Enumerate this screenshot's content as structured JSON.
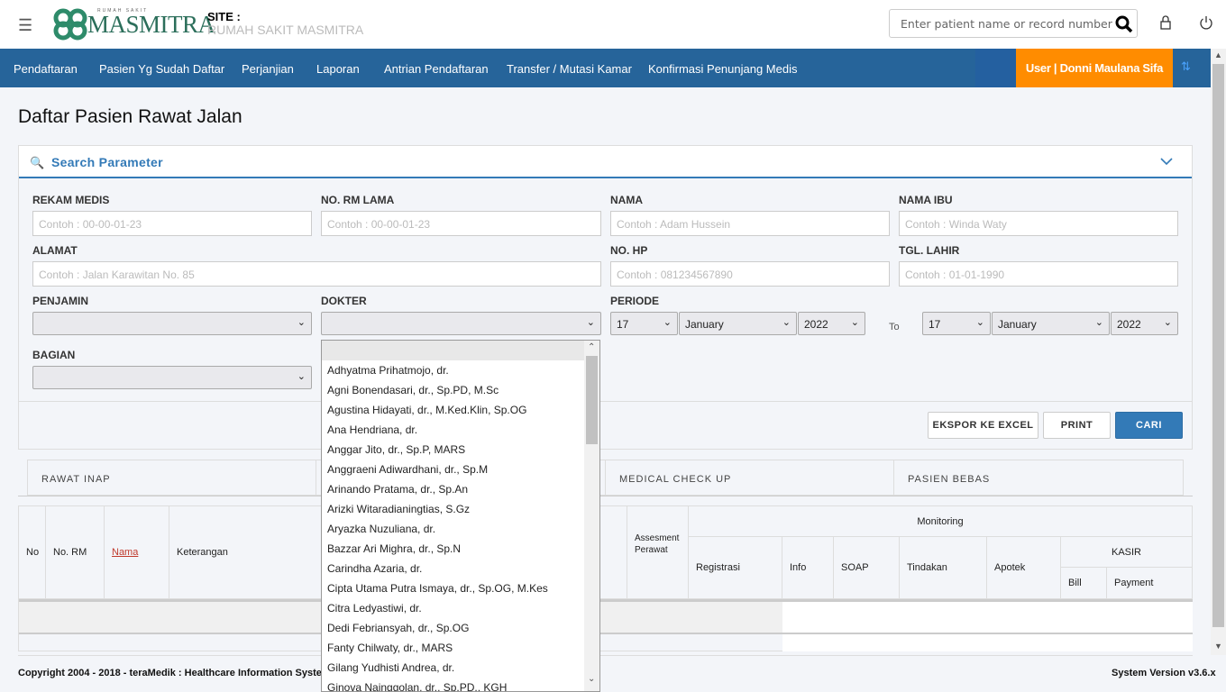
{
  "header": {
    "logo_small": "RUMAH SAKIT",
    "logo": "MASMITRA",
    "site_label": "SITE :",
    "site_name": "RUMAH SAKIT MASMITRA",
    "search_placeholder": "Enter patient name or record number"
  },
  "nav": {
    "items": [
      "Pendaftaran",
      "Pasien Yg Sudah Daftar",
      "Perjanjian",
      "Laporan",
      "Antrian Pendaftaran",
      "Transfer / Mutasi Kamar",
      "Konfirmasi Penunjang Medis"
    ],
    "user": "User | Donni Maulana Sifa"
  },
  "page": {
    "title": "Daftar Pasien Rawat Jalan"
  },
  "search": {
    "title": "Search Parameter",
    "fields": {
      "rekam_medis": {
        "label": "REKAM MEDIS",
        "placeholder": "Contoh : 00-00-01-23"
      },
      "no_rm_lama": {
        "label": "NO. RM LAMA",
        "placeholder": "Contoh : 00-00-01-23"
      },
      "nama": {
        "label": "NAMA",
        "placeholder": "Contoh : Adam Hussein"
      },
      "nama_ibu": {
        "label": "NAMA IBU",
        "placeholder": "Contoh : Winda Waty"
      },
      "alamat": {
        "label": "ALAMAT",
        "placeholder": "Contoh : Jalan Karawitan No. 85"
      },
      "no_hp": {
        "label": "NO. HP",
        "placeholder": "Contoh : 081234567890"
      },
      "tgl_lahir": {
        "label": "TGL. LAHIR",
        "placeholder": "Contoh : 01-01-1990"
      },
      "penjamin": {
        "label": "PENJAMIN",
        "value": ""
      },
      "dokter": {
        "label": "DOKTER",
        "value": ""
      },
      "periode": {
        "label": "PERIODE",
        "from_day": "17",
        "from_month": "January",
        "from_year": "2022",
        "to": "To",
        "to_day": "17",
        "to_month": "January",
        "to_year": "2022"
      },
      "bagian": {
        "label": "BAGIAN",
        "value": ""
      }
    },
    "buttons": {
      "excel": "EKSPOR KE EXCEL",
      "print": "PRINT",
      "cari": "CARI"
    }
  },
  "dokter_options": [
    "",
    "Adhyatma Prihatmojo, dr.",
    "Agni Bonendasari, dr., Sp.PD, M.Sc",
    "Agustina Hidayati, dr., M.Ked.Klin, Sp.OG",
    "Ana Hendriana, dr.",
    "Anggar Jito, dr., Sp.P, MARS",
    "Anggraeni Adiwardhani, dr., Sp.M",
    "Arinando Pratama, dr., Sp.An",
    "Arizki Witaradianingtias, S.Gz",
    "Aryazka Nuzuliana, dr.",
    "Bazzar Ari Mighra, dr., Sp.N",
    "Carindha Azaria, dr.",
    "Cipta Utama Putra Ismaya, dr., Sp.OG, M.Kes",
    "Citra Ledyastiwi, dr.",
    "Dedi Febriansyah, dr., Sp.OG",
    "Fanty Chilwaty, dr., MARS",
    "Gilang Yudhisti Andrea, dr.",
    "Ginova Nainggolan, dr., Sp.PD., KGH"
  ],
  "tabs": [
    "RAWAT INAP",
    "",
    "MEDICAL CHECK UP",
    "PASIEN BEBAS"
  ],
  "table": {
    "no": "No",
    "no_rm": "No. RM",
    "nama": "Nama",
    "keterangan": "Keterangan",
    "assesment": "Assesment Perawat",
    "monitoring": "Monitoring",
    "registrasi": "Registrasi",
    "info": "Info",
    "soap": "SOAP",
    "tindakan": "Tindakan",
    "apotek": "Apotek",
    "kasir": "KASIR",
    "bill": "Bill",
    "payment": "Payment"
  },
  "footer": {
    "copyright_pre": "Copyright 2004 - 2018 - tera",
    "copyright_brand": "Medik",
    "copyright_post": " : Healthcare Information System",
    "version": "System Version v3.6.x"
  },
  "colors": {
    "nav": "#26649a",
    "user": "#ff8c00",
    "accent": "#337ab7"
  }
}
